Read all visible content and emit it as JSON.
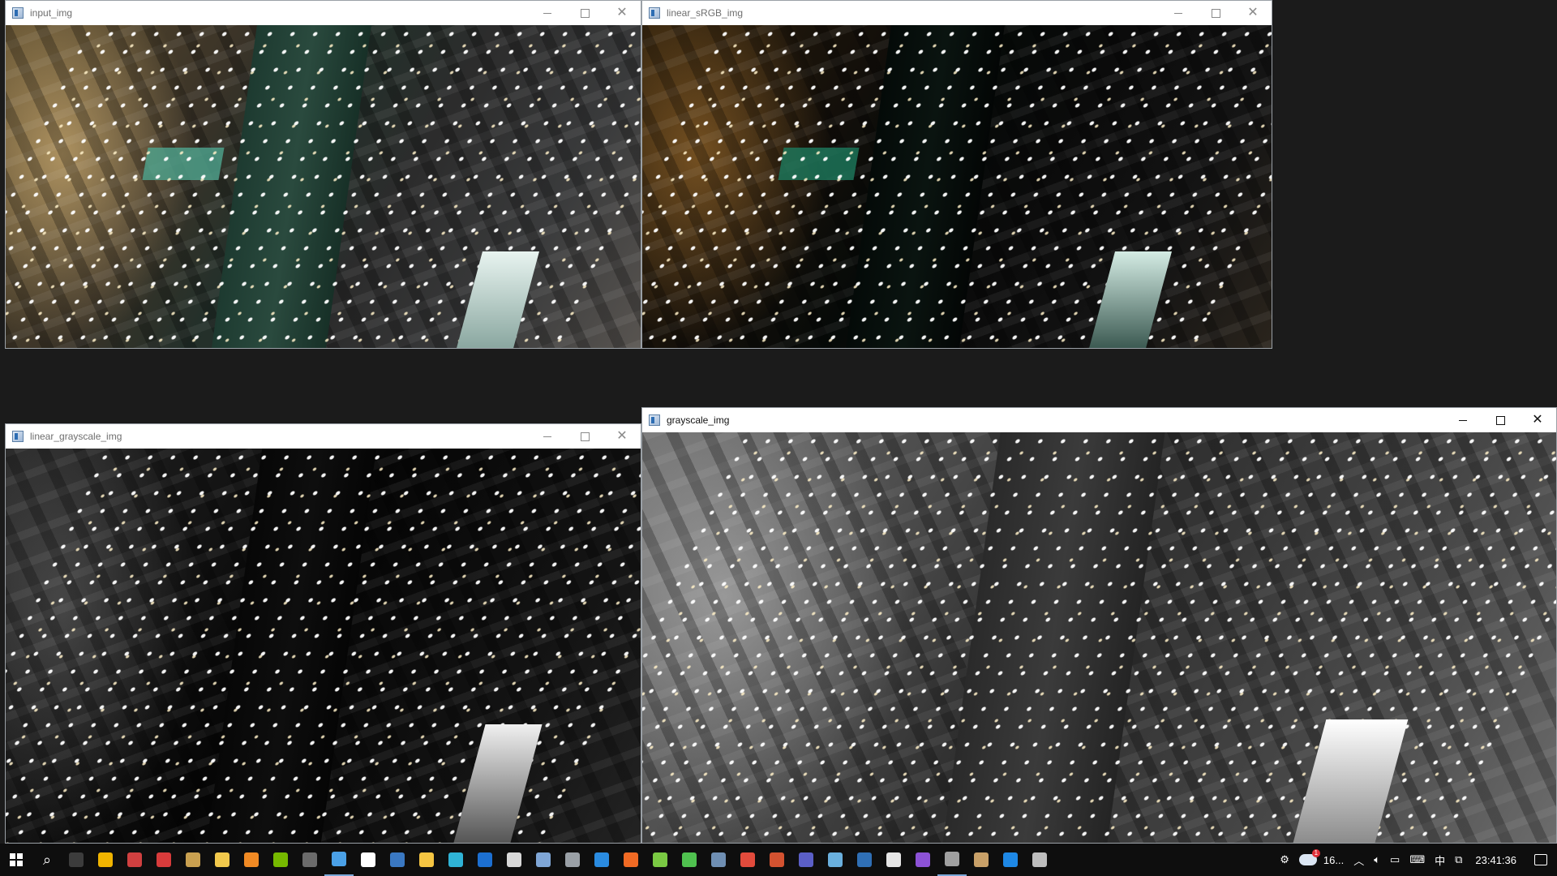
{
  "windows": {
    "input": {
      "title": "input_img"
    },
    "linear_srgb": {
      "title": "linear_sRGB_img"
    },
    "linear_gray": {
      "title": "linear_grayscale_img"
    },
    "gray": {
      "title": "grayscale_img"
    }
  },
  "window_controls": {
    "minimize": "—",
    "maximize": "□",
    "close": "✕"
  },
  "taskbar": {
    "pinned_icons": [
      {
        "name": "terminal-icon",
        "color": "#3c3c3c"
      },
      {
        "name": "chrome-canary-icon",
        "color": "#f0b400"
      },
      {
        "name": "recorder-icon",
        "color": "#d04040"
      },
      {
        "name": "todo-icon",
        "color": "#d83b3b"
      },
      {
        "name": "app-icon",
        "color": "#c9a050"
      },
      {
        "name": "file-explorer-icon",
        "color": "#f2c94c"
      },
      {
        "name": "search-tool-icon",
        "color": "#f08a24"
      },
      {
        "name": "nvidia-icon",
        "color": "#76b900"
      },
      {
        "name": "film-icon",
        "color": "#6b6b6b"
      },
      {
        "name": "monitor-icon",
        "color": "#4aa0e6"
      },
      {
        "name": "shield-icon",
        "color": "#ffffff"
      },
      {
        "name": "app-l-icon",
        "color": "#3a78c2"
      },
      {
        "name": "notes-icon",
        "color": "#f5c542"
      },
      {
        "name": "edge-icon",
        "color": "#2fb3d6"
      },
      {
        "name": "taskview-icon",
        "color": "#1c6fd1"
      },
      {
        "name": "security-icon",
        "color": "#d8d8d8"
      },
      {
        "name": "remote-icon",
        "color": "#7fa6d6"
      },
      {
        "name": "cube-icon",
        "color": "#9aa0a6"
      },
      {
        "name": "vscode-icon",
        "color": "#2a8be0"
      },
      {
        "name": "firefox-icon",
        "color": "#f06a24"
      },
      {
        "name": "paint-icon",
        "color": "#7ac943"
      },
      {
        "name": "sync-icon",
        "color": "#4fc14f"
      },
      {
        "name": "steam-icon",
        "color": "#6f8fb3"
      },
      {
        "name": "chrome-icon",
        "color": "#e24b3c"
      },
      {
        "name": "powerpoint-icon",
        "color": "#d35230"
      },
      {
        "name": "teams-icon",
        "color": "#5b5fc7"
      },
      {
        "name": "doc-icon",
        "color": "#6ab0de"
      },
      {
        "name": "powershell-icon",
        "color": "#2f6fb5"
      },
      {
        "name": "notepad-icon",
        "color": "#e6e6e6"
      },
      {
        "name": "vs-icon",
        "color": "#8c52d6"
      },
      {
        "name": "misc-icon",
        "color": "#a0a0a0"
      },
      {
        "name": "app2-icon",
        "color": "#c8a068"
      },
      {
        "name": "blue-app-icon",
        "color": "#1e88e5"
      },
      {
        "name": "network-app-icon",
        "color": "#bdbdbd"
      }
    ],
    "tray": {
      "weather_temp": "16...",
      "weather_badge": "1",
      "ime": "中",
      "time": "23:41:36"
    }
  }
}
